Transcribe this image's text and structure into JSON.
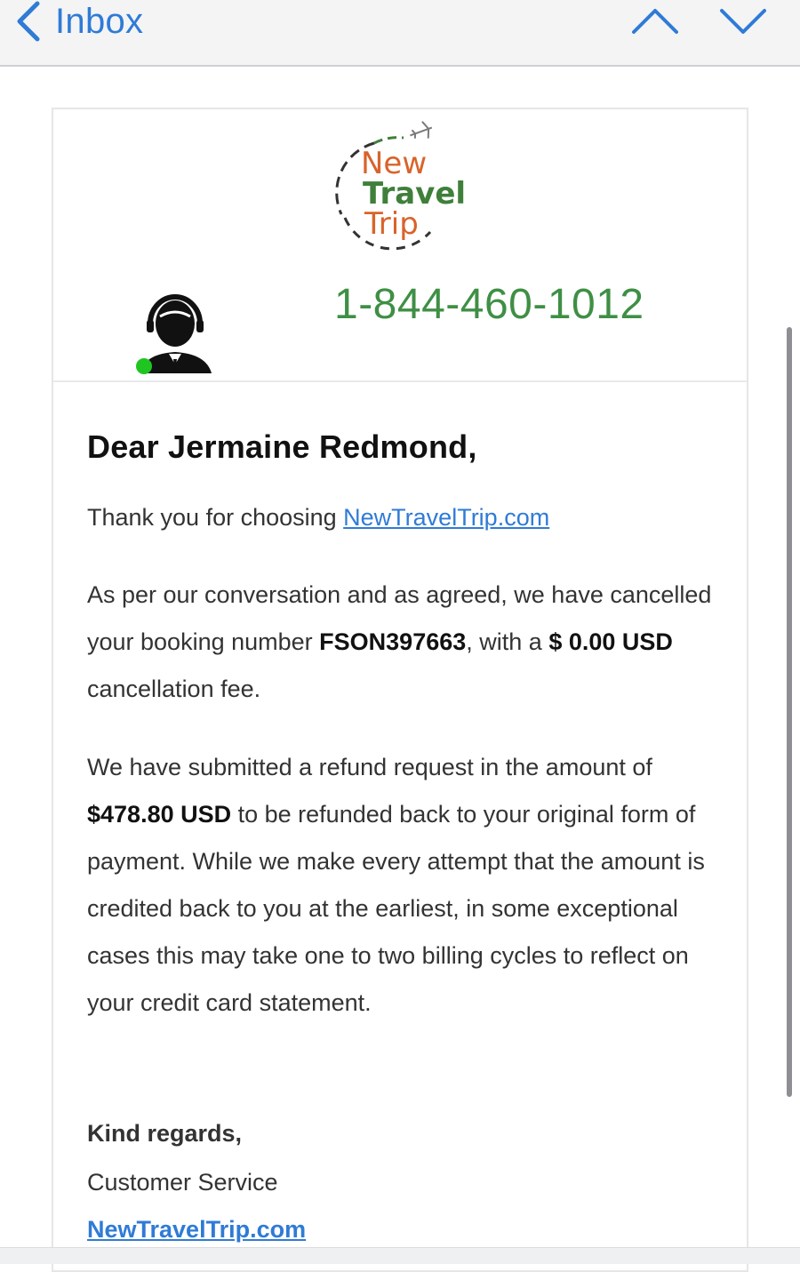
{
  "nav": {
    "back_label": "Inbox",
    "up_icon": "chevron-up-icon",
    "down_icon": "chevron-down-icon"
  },
  "email": {
    "logo": {
      "line1": "New",
      "line2": "Travel",
      "line3": "Trip"
    },
    "phone": "1-844-460-1012",
    "greeting": "Dear Jermaine Redmond,",
    "thanks_text": "Thank you for choosing ",
    "thanks_link": "NewTravelTrip.com",
    "cancel_text_1": "As per our conversation and as agreed, we have cancelled your booking number ",
    "booking_number": "FSON397663",
    "cancel_text_2": ", with a ",
    "cancel_fee": "$ 0.00 USD",
    "cancel_text_3": " cancellation fee.",
    "refund_text_1": "We have submitted a refund request in the amount of ",
    "refund_amount": "$478.80 USD",
    "refund_text_2": " to be refunded back to your original form of payment. While we make every attempt that the amount is credited back to you at the earliest, in some exceptional cases this may take one to two billing cycles to reflect on your credit card statement.",
    "regards": "Kind regards,",
    "signer": "Customer Service",
    "signature_link": "NewTravelTrip.com"
  },
  "colors": {
    "link_blue": "#2f7bd6",
    "phone_green": "#3f8f45",
    "logo_orange": "#d9632a",
    "logo_green": "#3f7f3a",
    "status_green": "#21c521"
  }
}
